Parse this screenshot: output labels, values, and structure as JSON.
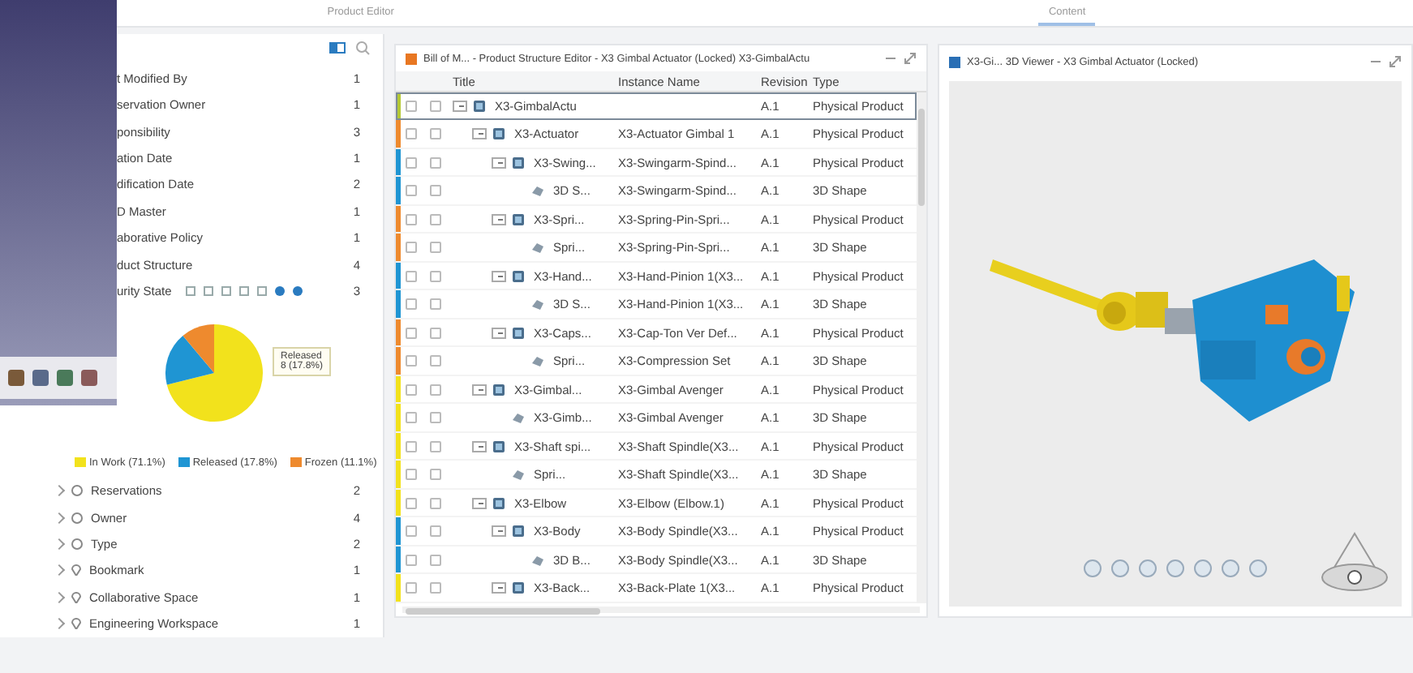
{
  "top_tabs": [
    {
      "label": "Product Editor",
      "selected": false
    },
    {
      "label": "Content",
      "selected": true
    }
  ],
  "facets": [
    {
      "label": "t Modified By",
      "count": "1"
    },
    {
      "label": "servation Owner",
      "count": "1"
    },
    {
      "label": "ponsibility",
      "count": "3"
    },
    {
      "label": "ation Date",
      "count": "1"
    },
    {
      "label": "dification Date",
      "count": "2"
    },
    {
      "label": "D Master",
      "count": "1"
    },
    {
      "label": "aborative Policy",
      "count": "1"
    },
    {
      "label": "duct Structure",
      "count": "4"
    },
    {
      "label": "urity State",
      "count": "3"
    }
  ],
  "maturity_chart": {
    "tooltip": [
      "Released",
      "8 (17.8%)"
    ],
    "chart_data": {
      "type": "pie",
      "categories": [
        "In Work",
        "Released",
        "Frozen"
      ],
      "values": [
        71.1,
        17.8,
        11.1
      ],
      "colors": [
        "#f2e21c",
        "#1f95d3",
        "#ee8a2e"
      ]
    },
    "legend_values": [
      "(71.1%)",
      "(17.8%)",
      "(11.1%)"
    ]
  },
  "groups": [
    {
      "label": "Reservations",
      "count": "2",
      "kind": "group"
    },
    {
      "label": "Owner",
      "count": "4",
      "kind": "group"
    },
    {
      "label": "Type",
      "count": "2",
      "kind": "group"
    },
    {
      "label": "Bookmark",
      "count": "1",
      "kind": "place"
    },
    {
      "label": "Collaborative Space",
      "count": "1",
      "kind": "place"
    },
    {
      "label": "Engineering Workspace",
      "count": "1",
      "kind": "place"
    }
  ],
  "structure_panel": {
    "title": "Bill of M... - Product Structure Editor - X3 Gimbal Actuator (Locked) X3-GimbalActu",
    "columns": [
      "Title",
      "Instance Name",
      "Revision",
      "Type"
    ],
    "rows": [
      {
        "kind": "product",
        "title": "X3-GimbalActu",
        "revision": "A.1",
        "type": "Physical Product",
        "color": "#b5c934",
        "selected": true,
        "expanded": true,
        "children": [
          {
            "kind": "product",
            "title": "X3-Actuator",
            "instance": "X3-Actuator Gimbal 1",
            "revision": "A.1",
            "type": "Physical Product",
            "color": "#ee8a2e",
            "selected": false,
            "expanded": true,
            "children": [
              {
                "kind": "product",
                "title": "X3-Swing...",
                "instance": "X3-Swingarm-Spind...",
                "revision": "A.1",
                "type": "Physical Product",
                "color": "#1f95d3",
                "selected": false,
                "expanded": true,
                "children": [
                  {
                    "kind": "shape",
                    "title": "3D S...",
                    "instance": "X3-Swingarm-Spind...",
                    "revision": "A.1",
                    "type": "3D Shape",
                    "color": "#1f95d3",
                    "selected": false
                  }
                ]
              },
              {
                "kind": "product",
                "title": "X3-Spri...",
                "instance": "X3-Spring-Pin-Spri...",
                "revision": "A.1",
                "type": "Physical Product",
                "color": "#ee8a2e",
                "selected": false,
                "expanded": true,
                "children": [
                  {
                    "kind": "shape",
                    "title": "Spri...",
                    "instance": "X3-Spring-Pin-Spri...",
                    "revision": "A.1",
                    "type": "3D Shape",
                    "color": "#ee8a2e",
                    "selected": false
                  }
                ]
              },
              {
                "kind": "product",
                "title": "X3-Hand...",
                "instance": "X3-Hand-Pinion 1(X3...",
                "revision": "A.1",
                "type": "Physical Product",
                "color": "#1f95d3",
                "selected": false,
                "expanded": true,
                "children": [
                  {
                    "kind": "shape",
                    "title": "3D S...",
                    "instance": "X3-Hand-Pinion 1(X3...",
                    "revision": "A.1",
                    "type": "3D Shape",
                    "color": "#1f95d3",
                    "selected": false
                  }
                ]
              },
              {
                "kind": "product",
                "title": "X3-Caps...",
                "instance": "X3-Cap-Ton Ver Def...",
                "revision": "A.1",
                "type": "Physical Product",
                "color": "#ee8a2e",
                "selected": false,
                "expanded": true,
                "children": [
                  {
                    "kind": "shape",
                    "title": "Spri...",
                    "instance": "X3-Compression Set",
                    "revision": "A.1",
                    "type": "3D Shape",
                    "color": "#ee8a2e",
                    "selected": false
                  }
                ]
              }
            ]
          },
          {
            "kind": "product",
            "title": "X3-Gimbal...",
            "instance": "X3-Gimbal Avenger",
            "revision": "A.1",
            "type": "Physical Product",
            "color": "#f2e21c",
            "selected": false,
            "expanded": true,
            "children": [
              {
                "kind": "shape",
                "title": "X3-Gimb...",
                "instance": "X3-Gimbal Avenger",
                "revision": "A.1",
                "type": "3D Shape",
                "color": "#f2e21c",
                "selected": false
              }
            ]
          },
          {
            "kind": "product",
            "title": "X3-Shaft spi...",
            "instance": "X3-Shaft Spindle(X3...",
            "revision": "A.1",
            "type": "Physical Product",
            "color": "#f2e21c",
            "selected": false,
            "expanded": true,
            "children": [
              {
                "kind": "shape",
                "title": "Spri...",
                "instance": "X3-Shaft Spindle(X3...",
                "revision": "A.1",
                "type": "3D Shape",
                "color": "#f2e21c",
                "selected": false
              }
            ]
          },
          {
            "kind": "product",
            "title": "X3-Elbow",
            "instance": "X3-Elbow (Elbow.1)",
            "revision": "A.1",
            "type": "Physical Product",
            "color": "#f2e21c",
            "selected": false,
            "expanded": true,
            "children": [
              {
                "kind": "product",
                "title": "X3-Body",
                "instance": "X3-Body Spindle(X3...",
                "revision": "A.1",
                "type": "Physical Product",
                "color": "#1f95d3",
                "selected": false,
                "expanded": true,
                "children": [
                  {
                    "kind": "shape",
                    "title": "3D B...",
                    "instance": "X3-Body Spindle(X3...",
                    "revision": "A.1",
                    "type": "3D Shape",
                    "color": "#1f95d3",
                    "selected": false
                  }
                ]
              },
              {
                "kind": "product",
                "title": "X3-Back...",
                "instance": "X3-Back-Plate 1(X3...",
                "revision": "A.1",
                "type": "Physical Product",
                "color": "#f2e21c",
                "selected": false,
                "expanded": true
              }
            ]
          }
        ]
      }
    ]
  },
  "viewer_panel": {
    "title": "X3-Gi... 3D Viewer - X3 Gimbal Actuator (Locked)"
  }
}
